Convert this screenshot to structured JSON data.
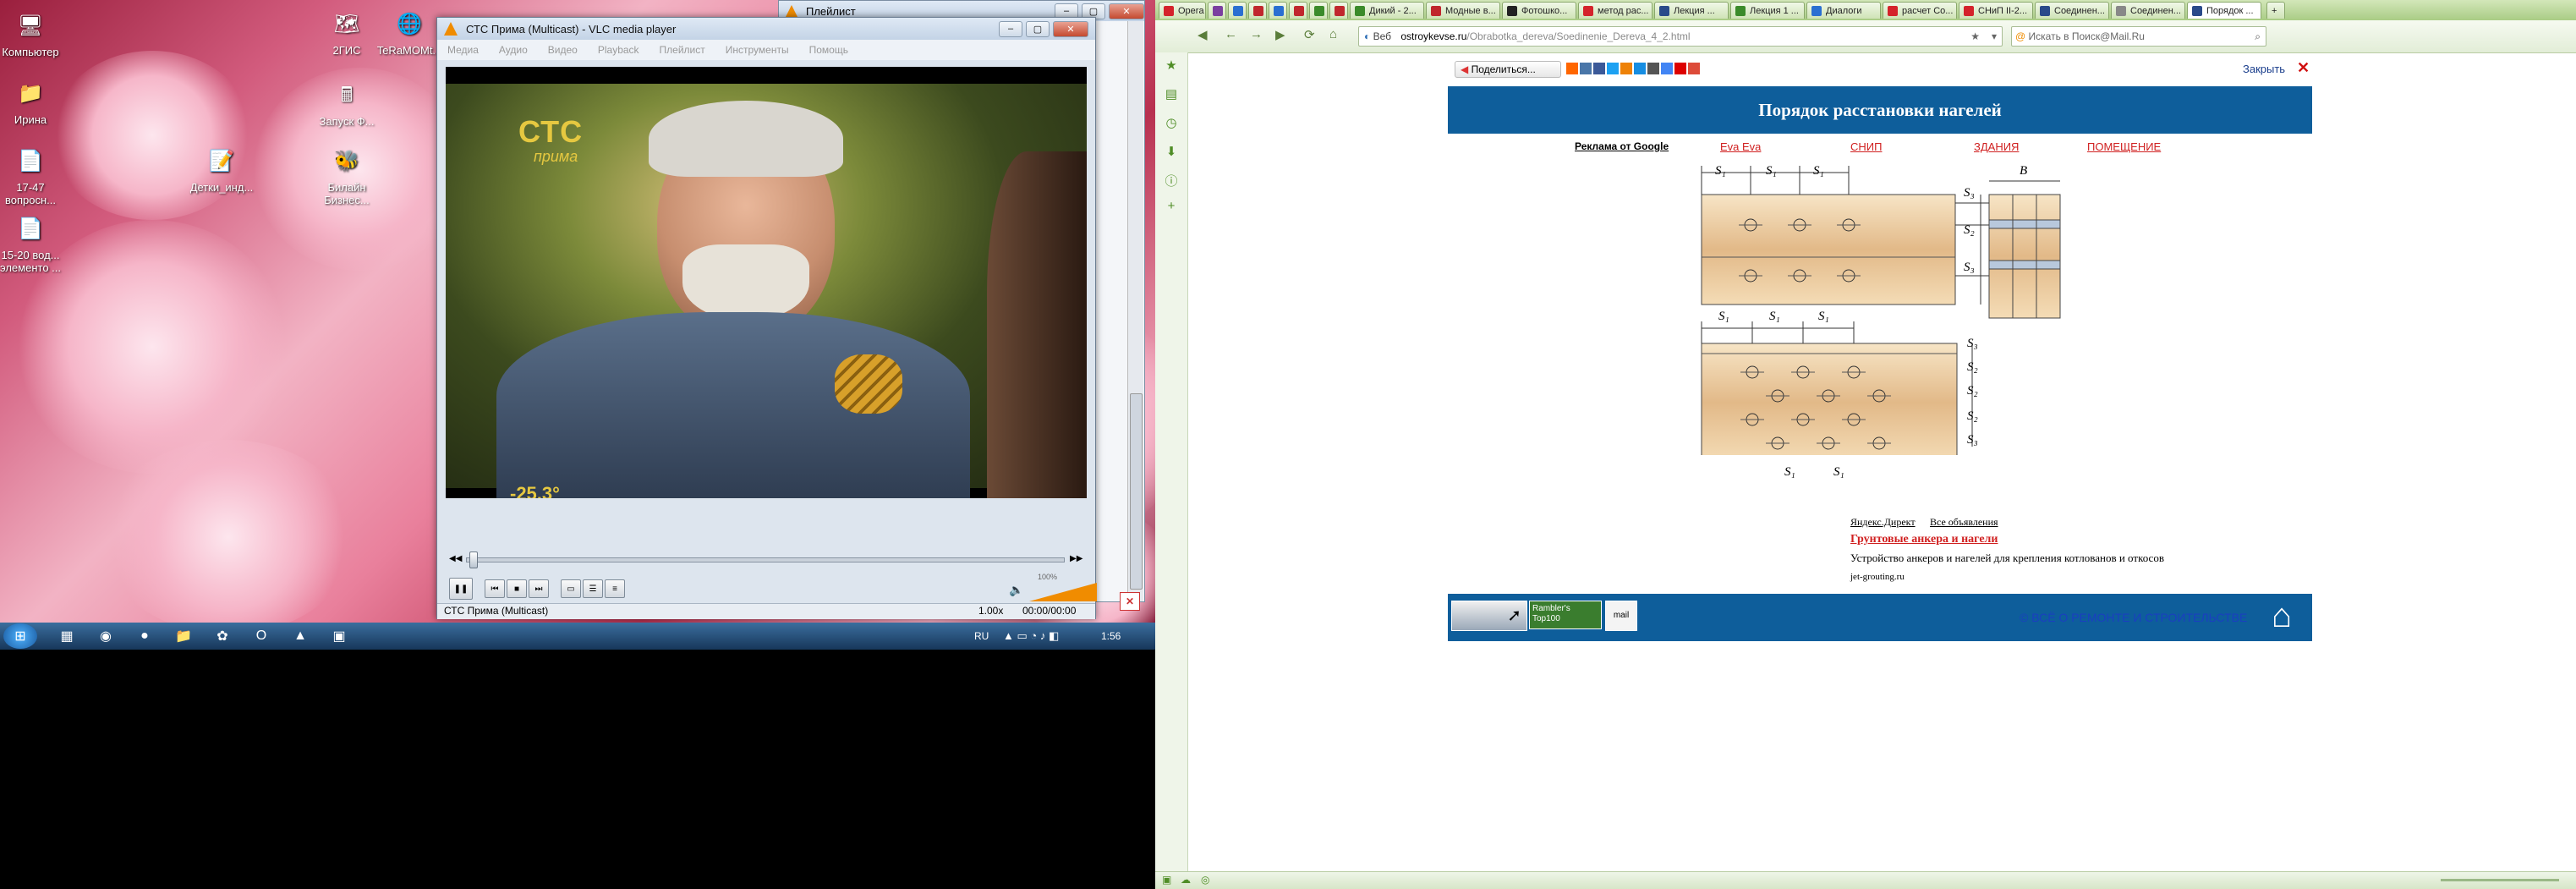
{
  "desktop": {
    "icons": [
      {
        "label": "Компьютер",
        "glyph": "🖥"
      },
      {
        "label": "Ирина",
        "glyph": "📁"
      },
      {
        "label": "17-47 вопросн...",
        "glyph": "📄"
      },
      {
        "label": "15-20 вод... элементо ...",
        "glyph": "📄"
      },
      {
        "label": "2ГИС",
        "glyph": "🗺"
      },
      {
        "label": "Запуск Ф...",
        "glyph": "🖩"
      },
      {
        "label": "Детки_инд...",
        "glyph": "📝"
      },
      {
        "label": "TeRaMOMt...",
        "glyph": "🌐"
      },
      {
        "label": "Билайн Бизнес...",
        "glyph": "🐝"
      }
    ]
  },
  "playlist": {
    "title": "Плейлист"
  },
  "vlc": {
    "title": "СТС Прима (Multicast) - VLC media player",
    "menu": [
      "Медиа",
      "Аудио",
      "Видео",
      "Playback",
      "Плейлист",
      "Инструменты",
      "Помощь"
    ],
    "channel_logo": "СТС",
    "channel_sub": "прима",
    "temperature": "-25,3°",
    "volume": "100%",
    "status_text": "СТС Прима (Multicast)",
    "speed": "1.00x",
    "time": "00:00/00:00",
    "buttons": {
      "play": "❚❚",
      "prev": "⏮",
      "stop": "■",
      "next": "⏭",
      "fullscreen": "▭",
      "playlist": "☰",
      "ext": "≡",
      "seek_back": "◀◀",
      "seek_fwd": "▶▶",
      "close_x": "✕"
    }
  },
  "taskbar": {
    "lang": "RU",
    "clock": "1:56"
  },
  "browser": {
    "tabs": [
      {
        "label": "Opera",
        "color": "#d4232b"
      },
      {
        "label": "",
        "color": "#7b3fa0"
      },
      {
        "label": "",
        "color": "#2a6fd1"
      },
      {
        "label": "",
        "color": "#c0272d"
      },
      {
        "label": "",
        "color": "#2a6fd1"
      },
      {
        "label": "",
        "color": "#c0272d"
      },
      {
        "label": "",
        "color": "#3b8b2a"
      },
      {
        "label": "",
        "color": "#c0272d"
      },
      {
        "label": "Дикий - 2...",
        "color": "#3b8b2a"
      },
      {
        "label": "Модные в...",
        "color": "#c0272d"
      },
      {
        "label": "Фотошко...",
        "color": "#222222"
      },
      {
        "label": "метод рас...",
        "color": "#d4232b"
      },
      {
        "label": "Лекция ...",
        "color": "#2a4a8a"
      },
      {
        "label": "Лекция 1 ...",
        "color": "#3b8b2a"
      },
      {
        "label": "Диалоги",
        "color": "#2a6fd1"
      },
      {
        "label": "расчет Со...",
        "color": "#d4232b"
      },
      {
        "label": "СНиП II-2...",
        "color": "#d4232b"
      },
      {
        "label": "Соединен...",
        "color": "#2a4a8a"
      },
      {
        "label": "Соединен...",
        "color": "#888888"
      },
      {
        "label": "Порядок ...",
        "color": "#2a4a8a"
      }
    ],
    "url_prefix": "Веб",
    "url_domain": "ostroykevse.ru",
    "url_path": "/Obrabotka_dereva/Soedinenie_Dereva_4_2.html",
    "search_placeholder": "Искать в Поиск@Mail.Ru"
  },
  "webpage": {
    "share_label": "Поделиться...",
    "close_label": "Закрыть",
    "title": "Порядок расстановки нагелей",
    "ads": {
      "google": "Реклама от Google",
      "links": [
        "Eva Eva",
        "СНИП",
        "ЗДАНИЯ",
        "ПОМЕЩЕНИЕ"
      ]
    },
    "diagram_labels": {
      "s1": "S₁",
      "s2": "S₂",
      "s3": "S₃",
      "b": "B"
    },
    "direct": {
      "label": "Яндекс.Директ",
      "all_ads": "Все объявления",
      "ad_title": "Грунтовые анкера и нагели",
      "ad_text": "Устройство анкеров и нагелей для крепления котлованов и откосов",
      "ad_url": "jet-grouting.ru"
    },
    "footer": {
      "copyright": "© ВСЁ О РЕМОНТЕ И СТРОИТЕЛЬСТВЕ",
      "rambler": "Rambler's Top100",
      "mail_label": "mail"
    }
  }
}
